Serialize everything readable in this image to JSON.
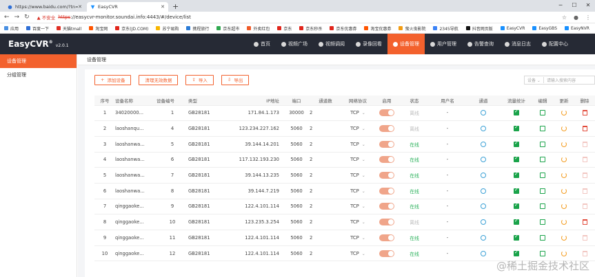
{
  "browser": {
    "tabs": [
      {
        "label": "https://www.baidu.com/?tn=3",
        "active": false
      },
      {
        "label": "EasyCVR",
        "active": true
      }
    ],
    "insecure_label": "不安全",
    "url_struck": "https",
    "url_rest": "://easycvr-monitor.soundai.info:4443/#/device/list",
    "bookmarks": [
      "应用",
      "百度一下",
      "天猫tmall",
      "淘宝网",
      "京东(JD.COM)",
      "苏宁易购",
      "携程旅行",
      "京东超市",
      "外卖红包",
      "京东",
      "京东秒杀",
      "京东优惠券",
      "淘宝优惠券",
      "萤火虫影院",
      "2345导航",
      "抖音网页版",
      "EasyCVR",
      "EasyGBS",
      "EasyNVR"
    ],
    "colors": {
      "bookmark_icons": [
        "#4a90e2",
        "#2f6fd6",
        "#e02e24",
        "#ff5500",
        "#e1251b",
        "#f8b600",
        "#2a7bd6",
        "#2fa84f",
        "#f05a28",
        "#e1251b",
        "#e1251b",
        "#e1251b",
        "#ff5500",
        "#f39c12",
        "#3b82f6",
        "#111111",
        "#1890ff",
        "#1890ff",
        "#1890ff"
      ]
    }
  },
  "app": {
    "logo": "EasyCVR",
    "logo_sup": "®",
    "version": "v2.0.1",
    "nav": [
      {
        "label": "首页",
        "icon": "home-icon",
        "active": false
      },
      {
        "label": "视频广场",
        "icon": "video-plaza-icon",
        "active": false
      },
      {
        "label": "视频调阅",
        "icon": "video-view-icon",
        "active": false
      },
      {
        "label": "录像回看",
        "icon": "playback-icon",
        "active": false
      },
      {
        "label": "设备管理",
        "icon": "device-icon",
        "active": true
      },
      {
        "label": "用户管理",
        "icon": "user-icon",
        "active": false
      },
      {
        "label": "告警查询",
        "icon": "alarm-icon",
        "active": false
      },
      {
        "label": "消息日志",
        "icon": "log-icon",
        "active": false
      },
      {
        "label": "配置中心",
        "icon": "config-icon",
        "active": false
      }
    ],
    "sidebar": [
      {
        "label": "设备管理",
        "active": true
      },
      {
        "label": "分组管理",
        "active": false
      }
    ],
    "breadcrumb": "设备管理",
    "buttons": {
      "add": "添加设备",
      "clean": "清理无效数据",
      "import": "导入",
      "export": "导出"
    },
    "search": {
      "select": "设备",
      "placeholder": "请输入搜索内容"
    },
    "columns": [
      "序号",
      "设备名称",
      "设备编号",
      "类型",
      "IP地址",
      "端口",
      "通道数",
      "网络协议",
      "启用",
      "状态",
      "用户名",
      "通道",
      "流量统计",
      "编辑",
      "更新",
      "删除"
    ],
    "rows": [
      {
        "no": "1",
        "name": "34020000...",
        "num": "1",
        "type": "GB28181",
        "ip": "171.84.1.173",
        "port": "30000",
        "ch": "2",
        "proto": "TCP",
        "status": "离线",
        "user": "-",
        "online": false
      },
      {
        "no": "2",
        "name": "laoshanqu...",
        "num": "4",
        "type": "GB28181",
        "ip": "123.234.227.162",
        "port": "5060",
        "ch": "2",
        "proto": "TCP",
        "status": "离线",
        "user": "-",
        "online": false
      },
      {
        "no": "3",
        "name": "laoshanwa...",
        "num": "5",
        "type": "GB28181",
        "ip": "39.144.14.201",
        "port": "5060",
        "ch": "2",
        "proto": "TCP",
        "status": "在线",
        "user": "-",
        "online": true
      },
      {
        "no": "4",
        "name": "laoshanwa...",
        "num": "6",
        "type": "GB28181",
        "ip": "117.132.193.230",
        "port": "5060",
        "ch": "2",
        "proto": "TCP",
        "status": "在线",
        "user": "-",
        "online": true
      },
      {
        "no": "5",
        "name": "laoshanwa...",
        "num": "7",
        "type": "GB28181",
        "ip": "39.144.13.235",
        "port": "5060",
        "ch": "2",
        "proto": "TCP",
        "status": "在线",
        "user": "-",
        "online": true
      },
      {
        "no": "6",
        "name": "laoshanwa...",
        "num": "8",
        "type": "GB28181",
        "ip": "39.144.7.219",
        "port": "5060",
        "ch": "2",
        "proto": "TCP",
        "status": "在线",
        "user": "-",
        "online": true
      },
      {
        "no": "7",
        "name": "qinggaoke...",
        "num": "9",
        "type": "GB28181",
        "ip": "122.4.101.114",
        "port": "5060",
        "ch": "2",
        "proto": "TCP",
        "status": "在线",
        "user": "-",
        "online": true
      },
      {
        "no": "8",
        "name": "qinggaoke...",
        "num": "10",
        "type": "GB28181",
        "ip": "123.235.3.254",
        "port": "5060",
        "ch": "2",
        "proto": "TCP",
        "status": "离线",
        "user": "-",
        "online": false
      },
      {
        "no": "9",
        "name": "qinggaoke...",
        "num": "11",
        "type": "GB28181",
        "ip": "122.4.101.114",
        "port": "5060",
        "ch": "2",
        "proto": "TCP",
        "status": "在线",
        "user": "-",
        "online": true
      },
      {
        "no": "10",
        "name": "qinggaoke...",
        "num": "12",
        "type": "GB28181",
        "ip": "122.4.101.114",
        "port": "5060",
        "ch": "2",
        "proto": "TCP",
        "status": "在线",
        "user": "-",
        "online": true
      }
    ],
    "watermark": "@稀土掘金技术社区",
    "accent": "#f3612d"
  }
}
